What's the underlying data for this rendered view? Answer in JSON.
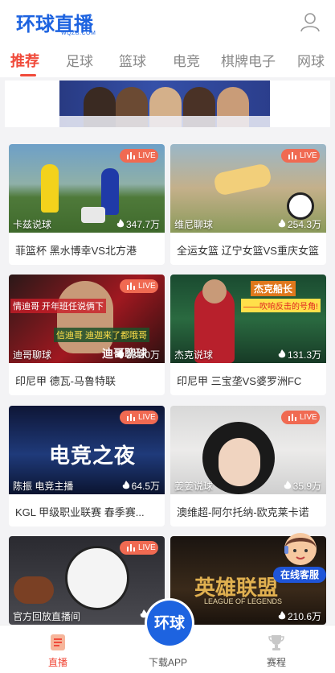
{
  "header": {
    "logo_text": "环球直播",
    "logo_sub": "WQZB.COM",
    "user_icon": "user-icon"
  },
  "tabs": [
    {
      "label": "推荐",
      "active": true
    },
    {
      "label": "足球",
      "active": false
    },
    {
      "label": "篮球",
      "active": false
    },
    {
      "label": "电竞",
      "active": false
    },
    {
      "label": "棋牌电子",
      "active": false
    },
    {
      "label": "网球",
      "active": false
    }
  ],
  "live_badge": "LIVE",
  "cards": [
    {
      "anchor": "卡兹说球",
      "heat": "347.7万",
      "title": "菲篮杯 黑水博幸VS北方港"
    },
    {
      "anchor": "维尼聊球",
      "heat": "254.3万",
      "title": "全运女篮 辽宁女篮VS重庆女篮"
    },
    {
      "anchor": "迪哥聊球",
      "heat": "231.0万",
      "title": "印尼甲 德瓦-马鲁特联"
    },
    {
      "anchor": "杰克说球",
      "heat": "131.3万",
      "title": "印尼甲 三宝垄VS婆罗洲FC"
    },
    {
      "anchor": "陈振 电竞主播",
      "heat": "64.5万",
      "title": "KGL 甲级职业联赛 春季赛..."
    },
    {
      "anchor": "姜姜说球",
      "heat": "35.9万",
      "title": "澳维超-阿尔托纳-欧克莱卡诺"
    },
    {
      "anchor": "官方回放直播间",
      "heat": "31",
      "title": ""
    },
    {
      "anchor": "",
      "heat": "210.6万",
      "title": ""
    }
  ],
  "thumb_texts": {
    "card3_overlay_1": "情迪哥 开年班任说俩下",
    "card3_overlay_2": "信迪哥 迪迦来了都哦哥",
    "card3_overlay_3": "迪哥聊球",
    "card4_overlay_1": "杰克船长",
    "card4_overlay_2": "——吹响反击的号角!",
    "card5_overlay_1": "电竞之夜",
    "card8_overlay_1": "英雄联盟",
    "card8_overlay_2": "LEAGUE OF LEGENDS"
  },
  "float_cs": {
    "label": "在线客服"
  },
  "bottom_nav": {
    "live": "直播",
    "download": "下载APP",
    "schedule": "赛程",
    "center_logo": "环球"
  },
  "colors": {
    "accent": "#f04a3a",
    "brand": "#1d63e0",
    "live_badge": "#f06a52"
  }
}
